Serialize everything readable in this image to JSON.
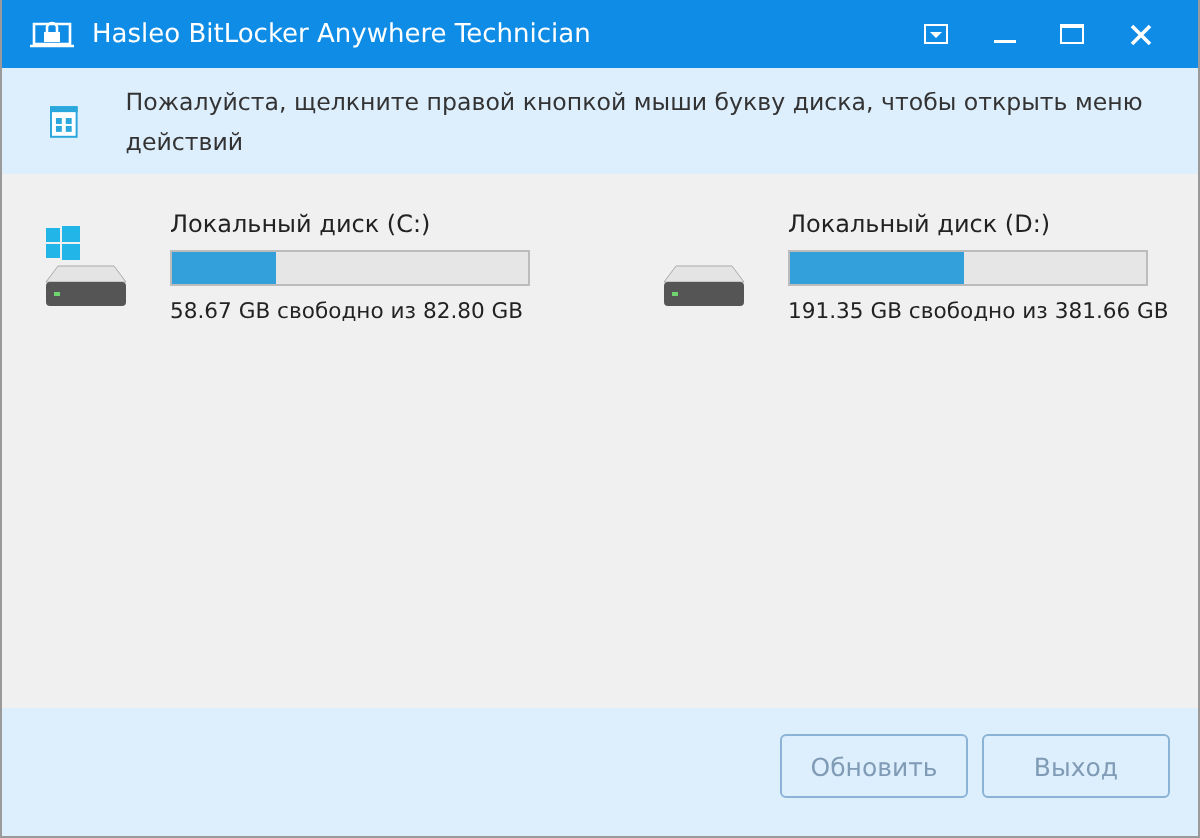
{
  "window": {
    "title": "Hasleo BitLocker Anywhere Technician"
  },
  "info": {
    "text": "Пожалуйста, щелкните правой кнопкой мыши букву диска, чтобы открыть меню действий"
  },
  "drives": [
    {
      "name": "Локальный диск (C:)",
      "kind": "system",
      "level": 0.29,
      "reading": "58.67 GB свободно из 82.80 GB"
    },
    {
      "name": "Локальный диск (D:)",
      "kind": "data",
      "level": 0.49,
      "reading": "191.35 GB свободно из 381.66 GB"
    }
  ],
  "buttons": [
    "Обновить",
    "Выход"
  ]
}
